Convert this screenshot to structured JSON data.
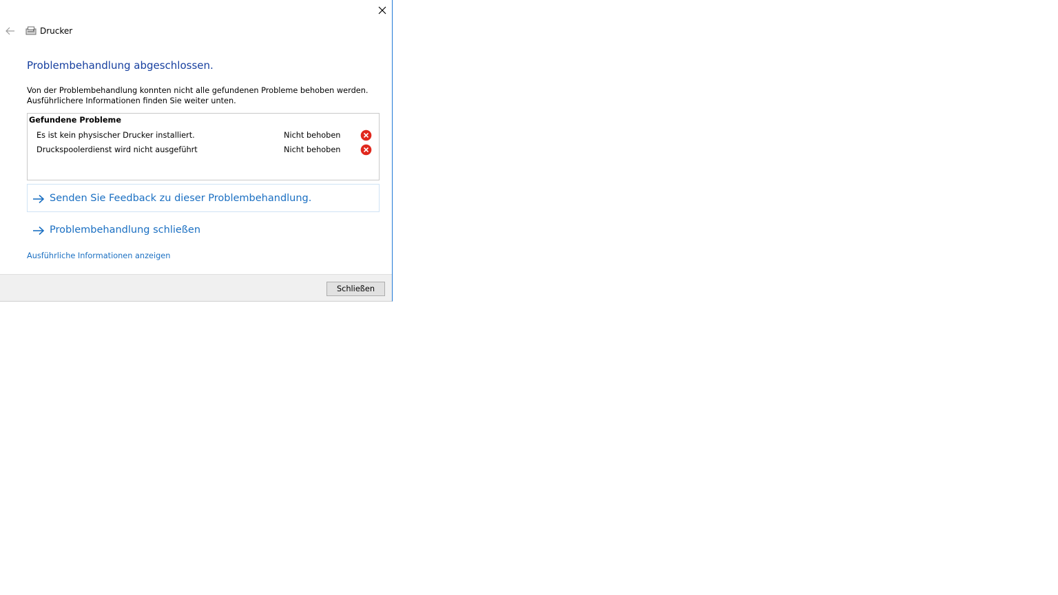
{
  "window": {
    "title": "Drucker"
  },
  "main": {
    "heading": "Problembehandlung abgeschlossen.",
    "description_line1": "Von der Problembehandlung konnten nicht alle gefundenen Probleme behoben werden.",
    "description_line2": "Ausführlichere Informationen finden Sie weiter unten."
  },
  "problems": {
    "title": "Gefundene Probleme",
    "items": [
      {
        "name": "Es ist kein physischer Drucker installiert.",
        "status": "Nicht behoben",
        "status_icon": "error-icon"
      },
      {
        "name": "Druckspoolerdienst wird nicht ausgeführt",
        "status": "Nicht behoben",
        "status_icon": "error-icon"
      }
    ]
  },
  "links": {
    "feedback": "Senden Sie Feedback zu dieser Problembehandlung.",
    "close_troubleshooter": "Problembehandlung schließen",
    "details": "Ausführliche Informationen anzeigen"
  },
  "footer": {
    "close_button": "Schließen"
  },
  "colors": {
    "heading": "#163f9f",
    "link": "#1a6fc2",
    "error": "#e0281d",
    "window_border": "#1e78d6",
    "footer_bg": "#f0f0f0"
  }
}
